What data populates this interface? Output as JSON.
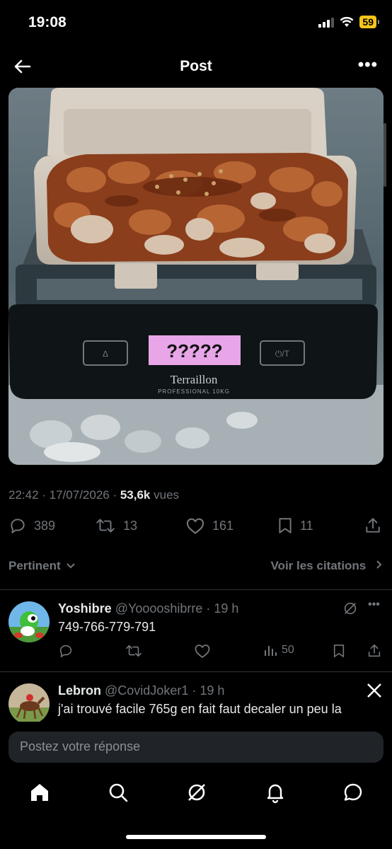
{
  "status_bar": {
    "time": "19:08",
    "battery": "59"
  },
  "header": {
    "title": "Post"
  },
  "photo": {
    "scale_brand": "Terraillon",
    "scale_model": "PROFESSIONAL 10KG",
    "scale_display": "?????",
    "scale_button_left": "∆",
    "scale_button_right": "⏻/T"
  },
  "post": {
    "timestamp": "22:42 · 17/07/2026 · ",
    "views_count": "53,6k",
    "views_label": " vues"
  },
  "actions": {
    "replies": "389",
    "reposts": "13",
    "likes": "161",
    "bookmarks": "11"
  },
  "sort": {
    "label": "Pertinent",
    "quotes_label": "Voir les citations"
  },
  "replies": [
    {
      "name": "Yoshibre",
      "handle": "@Yooooshibrre · 19 h",
      "text": "749-766-779-791",
      "views": "50"
    },
    {
      "name": "Lebron",
      "handle": "@CovidJoker1 · 19 h",
      "text": "j'ai trouvé facile 765g en fait faut decaler un peu la"
    }
  ],
  "composer": {
    "placeholder": "Postez votre réponse"
  },
  "colors": {
    "background": "#000000",
    "muted": "#71767b",
    "text": "#e7e9ea",
    "scale_display": "#e8a6e8"
  }
}
